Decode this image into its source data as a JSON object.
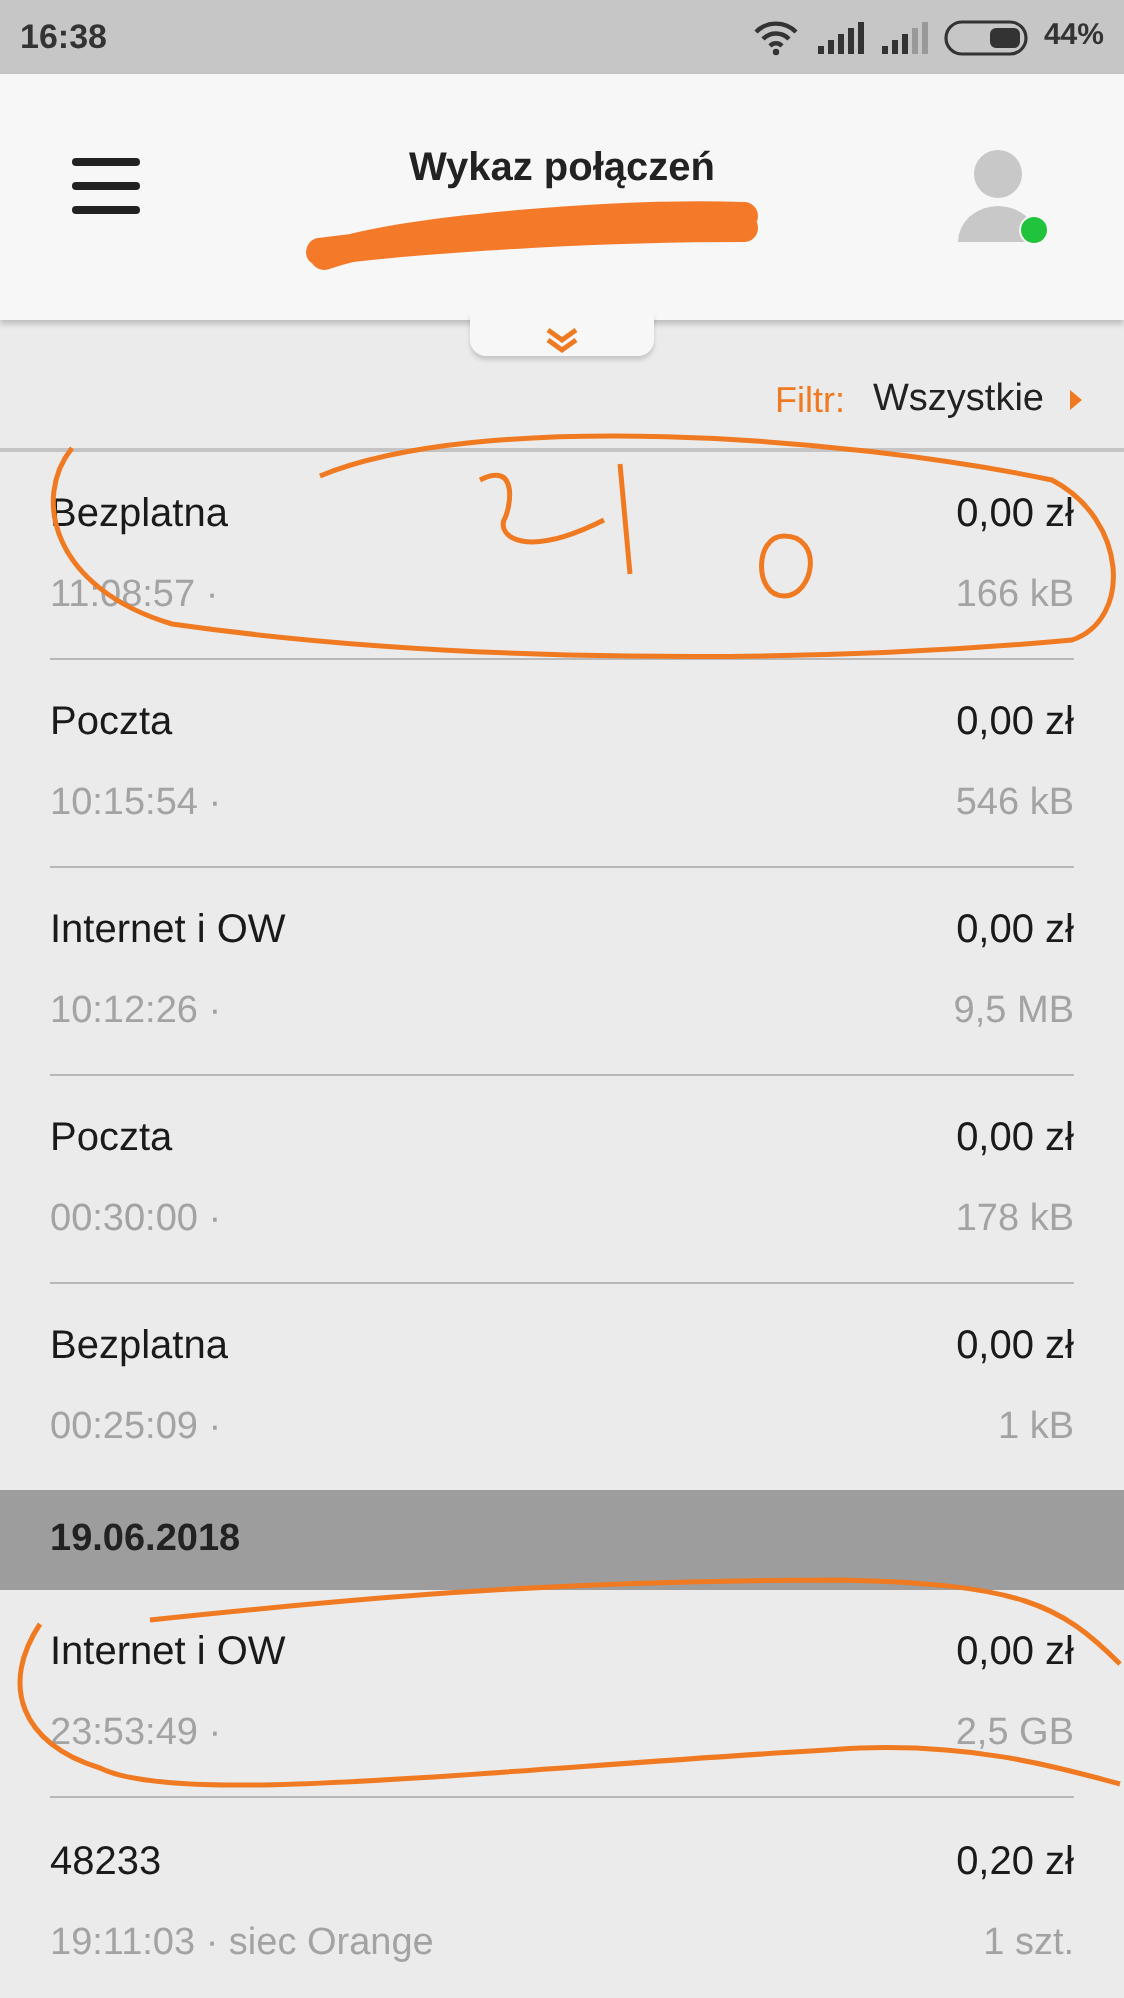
{
  "status_bar": {
    "time": "16:38",
    "battery": "44%"
  },
  "header": {
    "title": "Wykaz połączeń"
  },
  "filter": {
    "label": "Filtr:",
    "value": "Wszystkie"
  },
  "sections": [
    {
      "items": [
        {
          "name": "Bezplatna",
          "subtitle": "11:08:57 ·",
          "amount": "0,00 zł",
          "usage": "166 kB"
        },
        {
          "name": "Poczta",
          "subtitle": "10:15:54 ·",
          "amount": "0,00 zł",
          "usage": "546 kB"
        },
        {
          "name": "Internet i OW",
          "subtitle": "10:12:26 ·",
          "amount": "0,00 zł",
          "usage": "9,5 MB"
        },
        {
          "name": "Poczta",
          "subtitle": "00:30:00 ·",
          "amount": "0,00 zł",
          "usage": "178 kB"
        },
        {
          "name": "Bezplatna",
          "subtitle": "00:25:09 ·",
          "amount": "0,00 zł",
          "usage": "1 kB"
        }
      ]
    },
    {
      "date": "19.06.2018",
      "items": [
        {
          "name": "Internet i OW",
          "subtitle": "23:53:49 ·",
          "amount": "0,00 zł",
          "usage": "2,5 GB"
        },
        {
          "name": "48233",
          "subtitle": "19:11:03 · siec Orange",
          "amount": "0,20 zł",
          "usage": "1 szt."
        }
      ]
    }
  ]
}
